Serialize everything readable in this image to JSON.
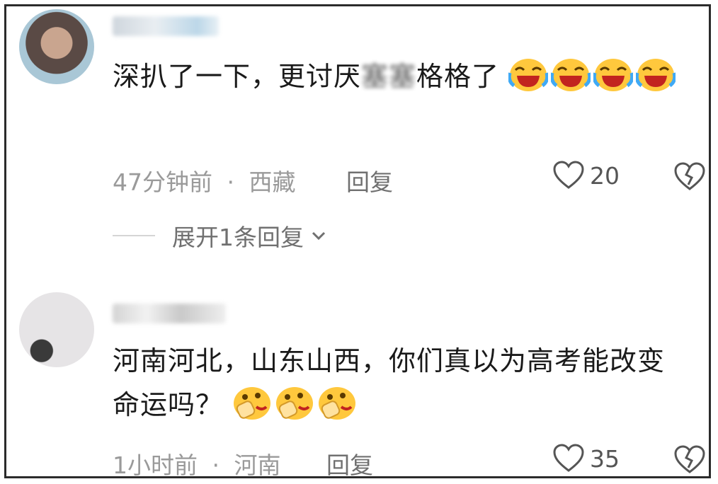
{
  "comments": [
    {
      "text_before": "深扒了一下，更讨厌",
      "text_blurred": "塞塞",
      "text_after": "格格了",
      "time": "47分钟前",
      "separator": "·",
      "location": "西藏",
      "reply_label": "回复",
      "likes": "20",
      "emoji": "laughing-crying-emoji",
      "emoji_count": 4
    },
    {
      "text": "河南河北，山东山西，你们真以为高考能改变命运吗？",
      "time": "1小时前",
      "separator": "·",
      "location": "河南",
      "reply_label": "回复",
      "likes": "35",
      "emoji": "salute-emoji",
      "emoji_count": 3
    }
  ],
  "expand_replies": "展开1条回复",
  "icons": {
    "like": "heart-icon",
    "dislike": "broken-heart-icon",
    "expand": "chevron-down-icon"
  },
  "colors": {
    "meta": "#9a9a9a",
    "text": "#1a1a1a",
    "emoji_yellow": "#ffc83d"
  }
}
